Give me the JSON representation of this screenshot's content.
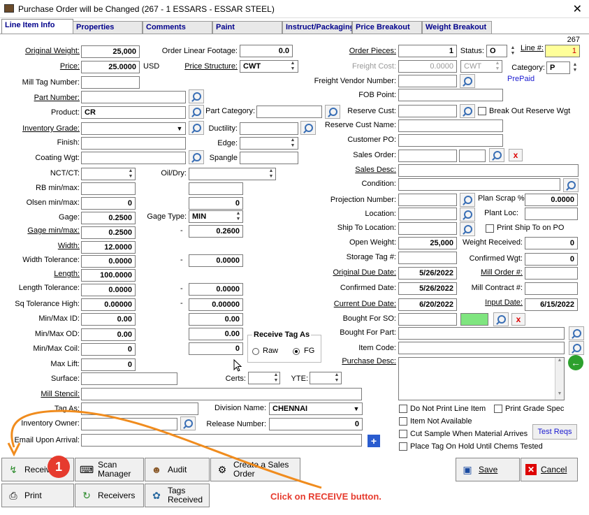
{
  "window": {
    "title": "Purchase Order will be Changed  (267 - 1  ESSARS -  ESSAR STEEL)",
    "close": "✕"
  },
  "tabs": [
    "Line Item Info",
    "Properties",
    "Comments",
    "Paint",
    "Instruct/Packaging",
    "Price Breakout",
    "Weight Breakout"
  ],
  "po_number": "267",
  "left": {
    "original_weight": {
      "label": "Original Weight:",
      "value": "25,000"
    },
    "price": {
      "label": "Price:",
      "value": "25.0000",
      "unit": "USD"
    },
    "mill_tag_number": {
      "label": "Mill Tag Number:",
      "value": ""
    },
    "part_number": {
      "label": "Part Number:",
      "value": ""
    },
    "product": {
      "label": "Product:",
      "value": "CR"
    },
    "inventory_grade": {
      "label": "Inventory Grade:",
      "value": ""
    },
    "finish": {
      "label": "Finish:",
      "value": ""
    },
    "coating_wgt": {
      "label": "Coating Wgt:",
      "value": ""
    },
    "nct_ct": {
      "label": "NCT/CT:",
      "value": ""
    },
    "rb_min_max": {
      "label": "RB min/max:",
      "value": ""
    },
    "olsen_min_max": {
      "label": "Olsen min/max:",
      "value": "0"
    },
    "gage": {
      "label": "Gage:",
      "value": "0.2500"
    },
    "gage_min_max": {
      "label": "Gage min/max:",
      "value": "0.2500"
    },
    "width": {
      "label": "Width:",
      "value": "12.0000"
    },
    "width_tolerance": {
      "label": "Width Tolerance:",
      "value": "0.0000"
    },
    "length": {
      "label": "Length:",
      "value": "100.0000"
    },
    "length_tolerance": {
      "label": "Length Tolerance:",
      "value": "0.0000"
    },
    "sq_tolerance_high": {
      "label": "Sq Tolerance High:",
      "value": "0.00000"
    },
    "min_max_id": {
      "label": "Min/Max ID:",
      "value": "0.00"
    },
    "min_max_od": {
      "label": "Min/Max OD:",
      "value": "0.00"
    },
    "min_max_coil": {
      "label": "Min/Max Coil:",
      "value": "0"
    },
    "max_lift": {
      "label": "Max Lift:",
      "value": "0"
    },
    "surface": {
      "label": "Surface:",
      "value": ""
    },
    "mill_stencil": {
      "label": "Mill Stencil:",
      "value": ""
    },
    "tag_as": {
      "label": "Tag As:",
      "value": ""
    },
    "inventory_owner": {
      "label": "Inventory Owner:",
      "value": ""
    },
    "email_upon_arrival": {
      "label": "Email Upon Arrival:",
      "value": ""
    }
  },
  "middle": {
    "order_linear_footage": {
      "label": "Order Linear Footage:",
      "value": "0.0"
    },
    "price_structure": {
      "label": "Price Structure:",
      "value": "CWT"
    },
    "part_category": {
      "label": "Part Category:",
      "value": ""
    },
    "ductility": {
      "label": "Ductility:",
      "value": ""
    },
    "edge": {
      "label": "Edge:",
      "value": ""
    },
    "spangle": {
      "label": "Spangle",
      "value": ""
    },
    "oil_dry": {
      "label": "Oil/Dry:",
      "value": ""
    },
    "rb_max": {
      "value": ""
    },
    "olsen_max": {
      "value": "0"
    },
    "gage_type": {
      "label": "Gage Type:",
      "value": "MIN"
    },
    "gage_max": {
      "dash": "-",
      "value": "0.2600"
    },
    "width_tol_max": {
      "dash": "-",
      "value": "0.0000"
    },
    "length_tol_max": {
      "dash": "-",
      "value": "0.0000"
    },
    "sq_tol_max": {
      "dash": "-",
      "value": "0.00000"
    },
    "id_max": {
      "value": "0.00"
    },
    "od_max": {
      "value": "0.00"
    },
    "coil_max": {
      "value": "0"
    },
    "receive_tag_as": {
      "label": "Receive Tag As",
      "raw": "Raw",
      "fg": "FG"
    },
    "certs": {
      "label": "Certs:",
      "value": ""
    },
    "yte": {
      "label": "YTE:",
      "value": ""
    },
    "division_name": {
      "label": "Division Name:",
      "value": "CHENNAI"
    },
    "release_number": {
      "label": "Release Number:",
      "value": "0"
    }
  },
  "right": {
    "order_pieces": {
      "label": "Order Pieces:",
      "value": "1"
    },
    "status": {
      "label": "Status:",
      "value": "O"
    },
    "line_no": {
      "label": "Line #:",
      "value": "1"
    },
    "freight_cost": {
      "label": "Freight Cost:",
      "value": "0.0000",
      "unit": "CWT"
    },
    "category": {
      "label": "Category:",
      "value": "P"
    },
    "prepaid": "PrePaid",
    "freight_vendor_number": {
      "label": "Freight Vendor Number:",
      "value": ""
    },
    "fob_point": {
      "label": "FOB Point:",
      "value": ""
    },
    "reserve_cust": {
      "label": "Reserve Cust:",
      "value": ""
    },
    "break_out_reserve_wgt": "Break Out Reserve Wgt",
    "reserve_cust_name": {
      "label": "Reserve Cust Name:",
      "value": ""
    },
    "customer_po": {
      "label": "Customer PO:",
      "value": ""
    },
    "sales_order": {
      "label": "Sales Order:",
      "value": ""
    },
    "sales_desc": {
      "label": "Sales Desc:",
      "value": ""
    },
    "condition": {
      "label": "Condition:",
      "value": ""
    },
    "projection_number": {
      "label": "Projection Number:",
      "value": ""
    },
    "plan_scrap": {
      "label": "Plan Scrap %",
      "value": "0.0000"
    },
    "location": {
      "label": "Location:",
      "value": ""
    },
    "plant_loc": {
      "label": "Plant Loc:",
      "value": ""
    },
    "ship_to_location": {
      "label": "Ship To Location:",
      "value": ""
    },
    "print_ship_to_on_po": "Print Ship To on PO",
    "open_weight": {
      "label": "Open Weight:",
      "value": "25,000"
    },
    "weight_received": {
      "label": "Weight Received:",
      "value": "0"
    },
    "storage_tag": {
      "label": "Storage Tag #:",
      "value": ""
    },
    "confirmed_wgt": {
      "label": "Confirmed Wgt:",
      "value": "0"
    },
    "original_due_date": {
      "label": "Original Due Date:",
      "value": "5/26/2022"
    },
    "mill_order": {
      "label": "Mill Order #:",
      "value": ""
    },
    "confirmed_date": {
      "label": "Confirmed Date:",
      "value": "5/26/2022"
    },
    "mill_contract": {
      "label": "Mill Contract #:",
      "value": ""
    },
    "current_due_date": {
      "label": "Current Due Date:",
      "value": "6/20/2022"
    },
    "input_date": {
      "label": "Input Date:",
      "value": "6/15/2022"
    },
    "bought_for_so": {
      "label": "Bought For SO:",
      "value": ""
    },
    "bought_for_part": {
      "label": "Bought For Part:",
      "value": ""
    },
    "item_code": {
      "label": "Item Code:",
      "value": ""
    },
    "purchase_desc": {
      "label": "Purchase Desc:",
      "value": ""
    },
    "do_not_print_line_item": "Do Not Print Line Item",
    "print_grade_spec": "Print Grade Spec",
    "item_not_available": "Item Not Available",
    "cut_sample": "Cut Sample When Material Arrives",
    "test_reqs": "Test Reqs",
    "place_tag_on_hold": "Place Tag On Hold Until Chems Tested"
  },
  "buttons": {
    "receive": "Receive",
    "scan_manager": [
      "Scan",
      "Manager"
    ],
    "audit": "Audit",
    "create_sales_order": [
      "Create a Sales",
      "Order"
    ],
    "save": "Save",
    "cancel": "Cancel",
    "print": "Print",
    "receivers": "Receivers",
    "tags_received": [
      "Tags",
      "Received"
    ]
  },
  "annotation": {
    "badge": "1",
    "text": "Click on RECEIVE button.",
    "color": "#e63b2e"
  }
}
